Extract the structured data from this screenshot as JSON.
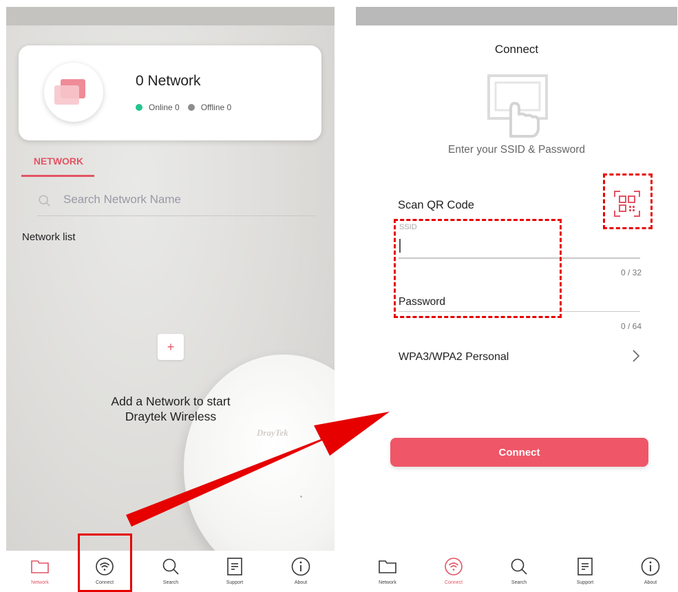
{
  "left_screen": {
    "card": {
      "title": "0 Network",
      "online_label": "Online 0",
      "offline_label": "Offline 0"
    },
    "tab_label": "NETWORK",
    "search": {
      "placeholder": "Search Network Name"
    },
    "network_list_label": "Network list",
    "add_button_label": "+",
    "add_text": [
      "Add a Network to start",
      "Draytek Wireless"
    ],
    "device_brand": "DrayTek",
    "nav": [
      {
        "label": "Network",
        "icon": "folder-icon",
        "active": true
      },
      {
        "label": "Connect",
        "icon": "wifi-icon",
        "active": false
      },
      {
        "label": "Search",
        "icon": "search-icon",
        "active": false
      },
      {
        "label": "Support",
        "icon": "document-icon",
        "active": false
      },
      {
        "label": "About",
        "icon": "info-icon",
        "active": false
      }
    ]
  },
  "right_screen": {
    "title": "Connect",
    "subtitle": "Enter your SSID & Password",
    "scan_label": "Scan QR Code",
    "ssid_label": "SSID",
    "ssid_count": "0 / 32",
    "password_label": "Password",
    "password_count": "0 / 64",
    "security_label": "WPA3/WPA2 Personal",
    "connect_button": "Connect",
    "nav": [
      {
        "label": "Network",
        "icon": "folder-icon",
        "active": false
      },
      {
        "label": "Connect",
        "icon": "wifi-icon",
        "active": true
      },
      {
        "label": "Search",
        "icon": "search-icon",
        "active": false
      },
      {
        "label": "Support",
        "icon": "document-icon",
        "active": false
      },
      {
        "label": "About",
        "icon": "info-icon",
        "active": false
      }
    ]
  },
  "colors": {
    "accent": "#ef5667",
    "annotation": "#e60000",
    "online": "#22c58e",
    "offline": "#8d8d8d"
  }
}
